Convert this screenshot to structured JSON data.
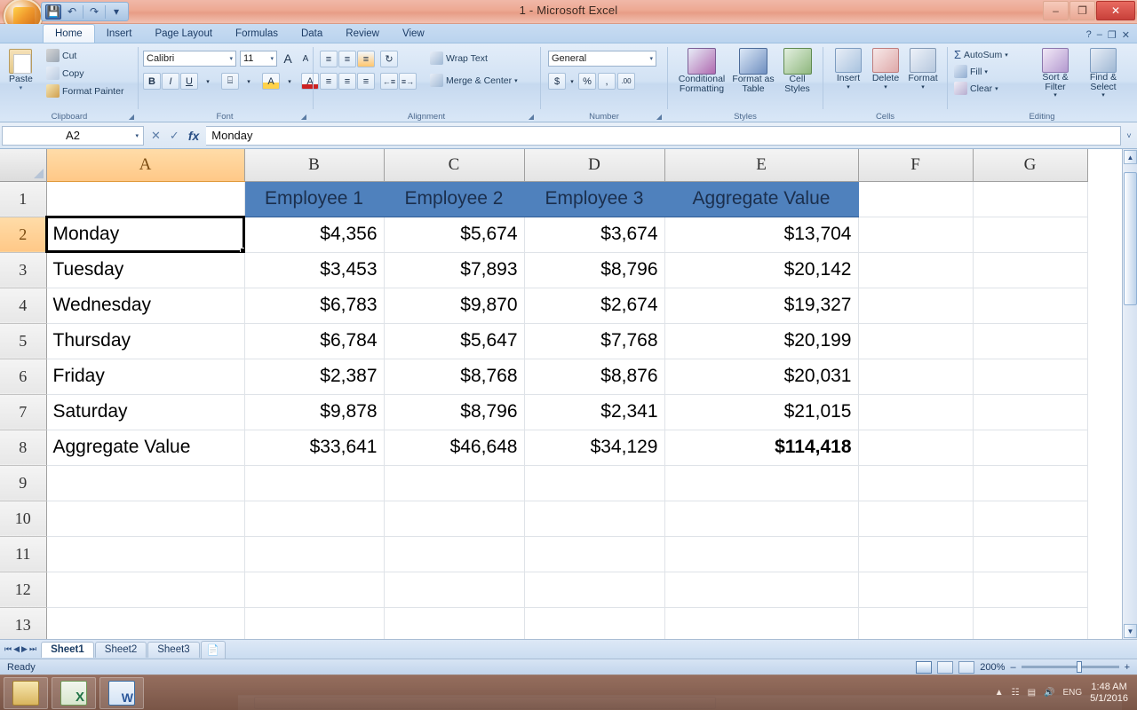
{
  "window": {
    "title": "1 - Microsoft Excel",
    "minimize_label": "–",
    "restore_label": "❐",
    "close_label": "✕"
  },
  "quick_access": {
    "office_button": "office-orb",
    "save_label": "💾",
    "undo_label": "↶",
    "redo_label": "↷",
    "customize_label": "▾"
  },
  "ribbon": {
    "tabs": [
      {
        "label": "Home",
        "active": true
      },
      {
        "label": "Insert",
        "active": false
      },
      {
        "label": "Page Layout",
        "active": false
      },
      {
        "label": "Formulas",
        "active": false
      },
      {
        "label": "Data",
        "active": false
      },
      {
        "label": "Review",
        "active": false
      },
      {
        "label": "View",
        "active": false
      }
    ],
    "help_label": "?",
    "minimize_ribbon_label": "–",
    "restore_ribbon_label": "❐",
    "close_doc_label": "✕",
    "groups": {
      "clipboard": {
        "label": "Clipboard",
        "paste": "Paste",
        "cut": "Cut",
        "copy": "Copy",
        "format_painter": "Format Painter"
      },
      "font": {
        "label": "Font",
        "font_name": "Calibri",
        "font_size": "11",
        "grow_font": "A",
        "shrink_font": "A",
        "bold": "B",
        "italic": "I",
        "underline": "U",
        "borders": "⌸",
        "fill_color": "A",
        "font_color": "A"
      },
      "alignment": {
        "label": "Alignment",
        "align_top": "≡",
        "align_middle": "≡",
        "align_bottom": "≡",
        "orientation": "↻",
        "align_left": "≡",
        "align_center": "≡",
        "align_right": "≡",
        "decrease_indent": "←≡",
        "increase_indent": "≡→",
        "wrap_text": "Wrap Text",
        "merge_center": "Merge & Center"
      },
      "number": {
        "label": "Number",
        "format": "General",
        "currency": "$",
        "percent": "%",
        "comma": ",",
        "increase_decimal": ".00",
        "decrease_decimal": ".0"
      },
      "styles": {
        "label": "Styles",
        "conditional_formatting": "Conditional Formatting",
        "format_as_table": "Format as Table",
        "cell_styles": "Cell Styles"
      },
      "cells": {
        "label": "Cells",
        "insert": "Insert",
        "delete": "Delete",
        "format": "Format"
      },
      "editing": {
        "label": "Editing",
        "autosum": "AutoSum",
        "fill": "Fill",
        "clear": "Clear",
        "sort_filter": "Sort & Filter",
        "find_select": "Find & Select"
      }
    }
  },
  "formula_bar": {
    "name_box": "A2",
    "cancel_label": "✕",
    "enter_label": "✓",
    "insert_function_label": "fx",
    "formula_value": "Monday",
    "expand_label": "˅"
  },
  "grid": {
    "select_all_label": "",
    "columns": [
      "A",
      "B",
      "C",
      "D",
      "E",
      "F",
      "G"
    ],
    "selected_column": "A",
    "selected_row": 2,
    "selected_cell": "A2",
    "rows": [
      {
        "n": "1",
        "cells": [
          "",
          "Employee 1",
          "Employee 2",
          "Employee 3",
          "Aggregate Value",
          "",
          ""
        ]
      },
      {
        "n": "2",
        "cells": [
          "Monday",
          "$4,356",
          "$5,674",
          "$3,674",
          "$13,704",
          "",
          ""
        ]
      },
      {
        "n": "3",
        "cells": [
          "Tuesday",
          "$3,453",
          "$7,893",
          "$8,796",
          "$20,142",
          "",
          ""
        ]
      },
      {
        "n": "4",
        "cells": [
          "Wednesday",
          "$6,783",
          "$9,870",
          "$2,674",
          "$19,327",
          "",
          ""
        ]
      },
      {
        "n": "5",
        "cells": [
          "Thursday",
          "$6,784",
          "$5,647",
          "$7,768",
          "$20,199",
          "",
          ""
        ]
      },
      {
        "n": "6",
        "cells": [
          "Friday",
          "$2,387",
          "$8,768",
          "$8,876",
          "$20,031",
          "",
          ""
        ]
      },
      {
        "n": "7",
        "cells": [
          "Saturday",
          "$9,878",
          "$8,796",
          "$2,341",
          "$21,015",
          "",
          ""
        ]
      },
      {
        "n": "8",
        "cells": [
          "Aggregate Value",
          "$33,641",
          "$46,648",
          "$34,129",
          "$114,418",
          "",
          ""
        ]
      },
      {
        "n": "9",
        "cells": [
          "",
          "",
          "",
          "",
          "",
          "",
          ""
        ]
      },
      {
        "n": "10",
        "cells": [
          "",
          "",
          "",
          "",
          "",
          "",
          ""
        ]
      },
      {
        "n": "11",
        "cells": [
          "",
          "",
          "",
          "",
          "",
          "",
          ""
        ]
      },
      {
        "n": "12",
        "cells": [
          "",
          "",
          "",
          "",
          "",
          "",
          ""
        ]
      },
      {
        "n": "13",
        "cells": [
          "",
          "",
          "",
          "",
          "",
          "",
          ""
        ]
      }
    ],
    "header_fill": "#4F81BD",
    "header_text_color": "#1b2f4d",
    "selection_header_fill": "#FFC887"
  },
  "sheet_tabs": {
    "first_label": "⏮",
    "prev_label": "◀",
    "next_label": "▶",
    "last_label": "⏭",
    "tabs": [
      {
        "label": "Sheet1",
        "active": true
      },
      {
        "label": "Sheet2",
        "active": false
      },
      {
        "label": "Sheet3",
        "active": false
      }
    ],
    "insert_sheet_label": "➕"
  },
  "status_bar": {
    "state": "Ready",
    "view_normal": "normal-view",
    "view_page_layout": "page-layout-view",
    "view_page_break": "page-break-view",
    "zoom": "200%",
    "zoom_out_label": "–",
    "zoom_in_label": "+"
  },
  "taskbar": {
    "items": [
      {
        "name": "file-explorer",
        "label": "📁"
      },
      {
        "name": "excel",
        "label": "X"
      },
      {
        "name": "word",
        "label": "W"
      }
    ],
    "tray": {
      "show_hidden_label": "▲",
      "network_label": "☷",
      "action_center_label": "▤",
      "volume_label": "🔊",
      "input_label": "ENG",
      "time": "1:48 AM",
      "date": "5/1/2016"
    }
  }
}
